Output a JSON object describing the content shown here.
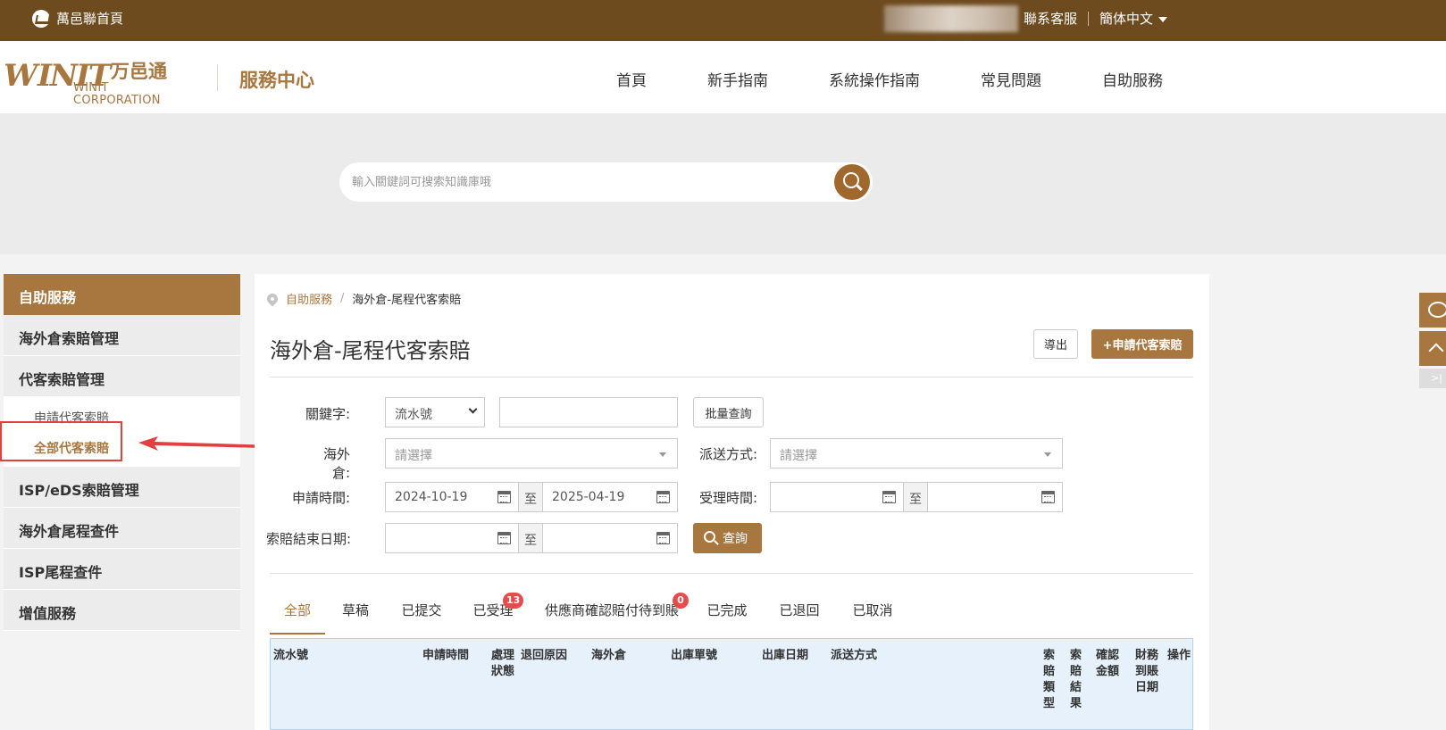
{
  "topbar": {
    "home": "萬邑聯首頁",
    "contact": "聯系客服",
    "language": "簡体中文"
  },
  "header": {
    "brand_mark": "INIT",
    "brand_cn": "万邑通",
    "brand_en": "WINIT CORPORATION",
    "service_center": "服務中心",
    "nav": [
      "首頁",
      "新手指南",
      "系統操作指南",
      "常見問題",
      "自助服務"
    ]
  },
  "search": {
    "placeholder": "輸入關鍵詞可搜索知識庫哦"
  },
  "sidebar": {
    "title": "自助服務",
    "items": [
      "海外倉索賠管理",
      "代客索賠管理",
      "ISP/eDS索賠管理",
      "海外倉尾程查件",
      "ISP尾程查件",
      "增值服務"
    ],
    "subitems": [
      "申請代客索賠",
      "全部代客索賠"
    ]
  },
  "breadcrumb": {
    "parent": "自助服務",
    "separator": "/",
    "current": "海外倉-尾程代客索賠"
  },
  "page": {
    "title": "海外倉-尾程代客索賠",
    "export_label": "導出",
    "apply_label": "+申請代客索賠"
  },
  "filters": {
    "keyword_label": "關鍵字:",
    "keyword_type": "流水號",
    "keyword_value": "",
    "batch_label": "批量查詢",
    "warehouse_label": "海外倉:",
    "warehouse_placeholder": "請選擇",
    "delivery_label": "派送方式:",
    "delivery_placeholder": "請選擇",
    "apply_time_label": "申請時間:",
    "apply_from": "2024-10-19",
    "apply_to": "2025-04-19",
    "to_label": "至",
    "accept_time_label": "受理時間:",
    "accept_from": "",
    "accept_to": "",
    "end_date_label": "索賠結束日期:",
    "end_from": "",
    "end_to": "",
    "query_label": "查詢"
  },
  "tabs": [
    {
      "label": "全部",
      "badge": ""
    },
    {
      "label": "草稿",
      "badge": ""
    },
    {
      "label": "已提交",
      "badge": ""
    },
    {
      "label": "已受理",
      "badge": "13"
    },
    {
      "label": "供應商確認賠付待到賬",
      "badge": "0"
    },
    {
      "label": "已完成",
      "badge": ""
    },
    {
      "label": "已退回",
      "badge": ""
    },
    {
      "label": "已取消",
      "badge": ""
    }
  ],
  "table": {
    "columns": [
      "流水號",
      "申請時間",
      "處理狀態",
      "退回原因",
      "海外倉",
      "出庫單號",
      "出庫日期",
      "派送方式",
      "索賠類型",
      "索賠結果",
      "確認金額",
      "財務到賬日期",
      "操作"
    ]
  },
  "colors": {
    "brand": "#a8773f",
    "topbar": "#6e4a1f",
    "badge": "#e84b4b",
    "highlight": "#e04040"
  }
}
